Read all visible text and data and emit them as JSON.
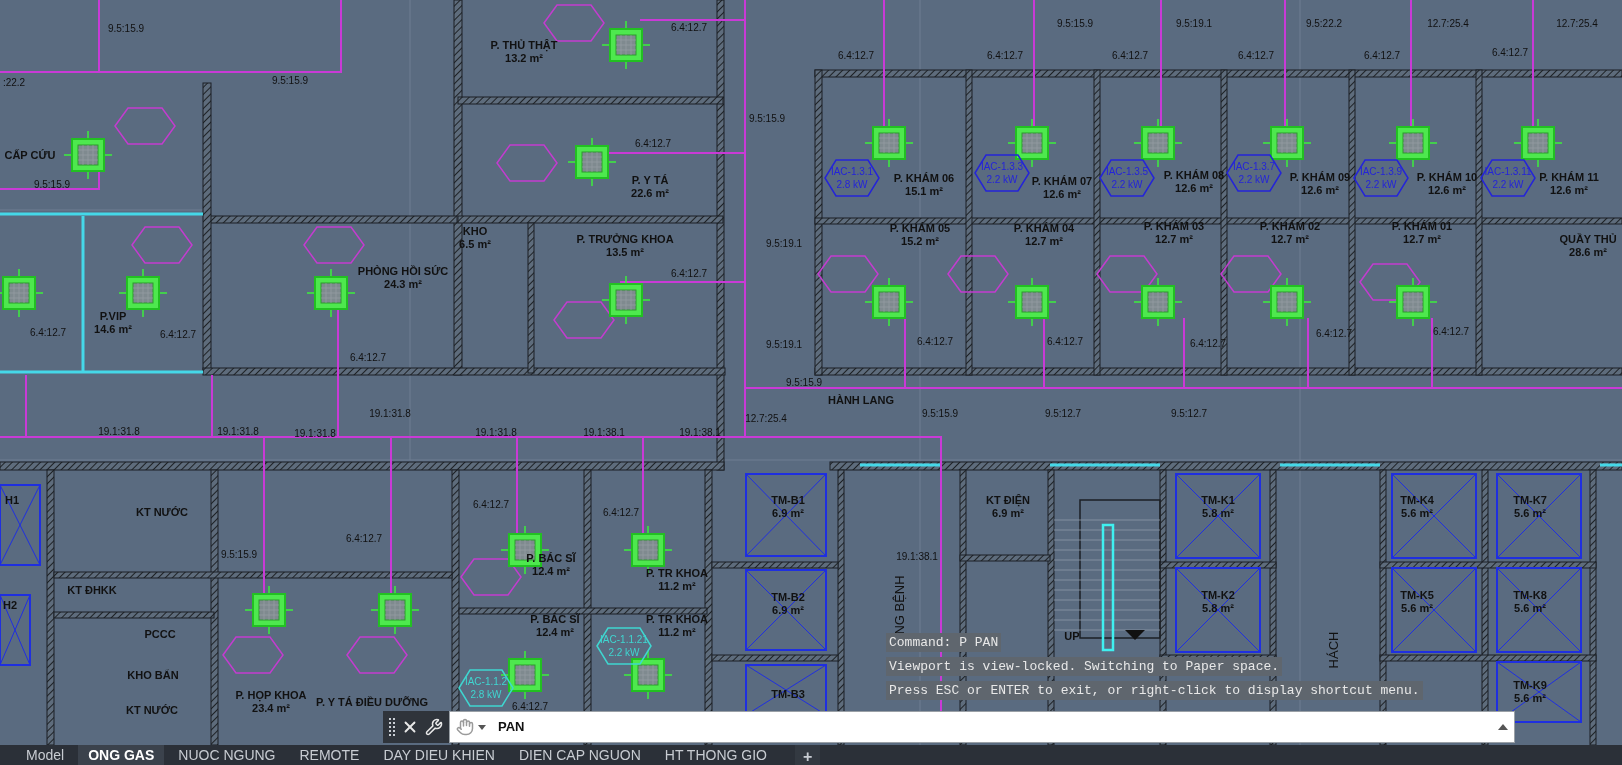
{
  "drawing": {
    "rooms": [
      {
        "name": "P. THỦ THẬT",
        "area": "13.2 m²"
      },
      {
        "name": "CẤP CỨU"
      },
      {
        "name": "P. Y TÁ",
        "area": "22.6 m²"
      },
      {
        "name": "KHO",
        "area": "6.5 m²"
      },
      {
        "name": "P. TRƯỞNG KHOA",
        "area": "13.5 m²"
      },
      {
        "name": "PHÒNG HỒI SỨC",
        "area": "24.3 m²"
      },
      {
        "name": "P.VIP",
        "area": "14.6 m²"
      },
      {
        "name": "P. KHÁM 06",
        "area": "15.1 m²"
      },
      {
        "name": "P. KHÁM 07",
        "area": "12.6 m²"
      },
      {
        "name": "P. KHÁM 08",
        "area": "12.6 m²"
      },
      {
        "name": "P. KHÁM 09",
        "area": "12.6 m²"
      },
      {
        "name": "P. KHÁM 10",
        "area": "12.6 m²"
      },
      {
        "name": "P. KHÁM 11",
        "area": "12.6 m²"
      },
      {
        "name": "P. KHÁM 05",
        "area": "15.2 m²"
      },
      {
        "name": "P. KHÁM 04",
        "area": "12.7 m²"
      },
      {
        "name": "P. KHÁM 03",
        "area": "12.7 m²"
      },
      {
        "name": "P. KHÁM 02",
        "area": "12.7 m²"
      },
      {
        "name": "P. KHÁM 01",
        "area": "12.7 m²"
      },
      {
        "name": "QUẦY THỦ",
        "area": "28.6 m²"
      },
      {
        "name": "HÀNH LANG"
      },
      {
        "name": "KT NƯỚC"
      },
      {
        "name": "KT ĐHKK"
      },
      {
        "name": "PCCC"
      },
      {
        "name": "KHO BẨN"
      },
      {
        "name": "KT NƯỚC"
      },
      {
        "name": "P. BÁC SĨ",
        "area": "12.4 m²"
      },
      {
        "name": "P. TR KHOA",
        "area": "11.2 m²"
      },
      {
        "name": "P. BÁC SĨ",
        "area": "12.4 m²"
      },
      {
        "name": "P. TR KHOA",
        "area": "11.2 m²"
      },
      {
        "name": "P. HỌP KHOA",
        "area": "23.4 m²"
      },
      {
        "name": "P. Y TÁ ĐIỀU DƯỠNG"
      },
      {
        "name": "TM-B1",
        "area": "6.9 m²"
      },
      {
        "name": "TM-B2",
        "area": "6.9 m²"
      },
      {
        "name": "TM-B3"
      },
      {
        "name": "KT ĐIỆN",
        "area": "6.9 m²"
      },
      {
        "name": "TM-K1",
        "area": "5.8 m²"
      },
      {
        "name": "TM-K2",
        "area": "5.8 m²"
      },
      {
        "name": "TM-K4",
        "area": "5.6 m²"
      },
      {
        "name": "TM-K5",
        "area": "5.6 m²"
      },
      {
        "name": "TM-K7",
        "area": "5.6 m²"
      },
      {
        "name": "TM-K8",
        "area": "5.6 m²"
      },
      {
        "name": "TM-K9",
        "area": "5.6 m²"
      },
      {
        "name": "UP"
      },
      {
        "name": "H1"
      },
      {
        "name": "H2"
      }
    ],
    "vertical_labels": [
      "NG BỆNH",
      "HÁCH"
    ],
    "pipe_labels": [
      "9.5:15.9",
      "6.4:12.7",
      "9.5:15.9",
      "9.5:19.1",
      "9.5:22.2",
      "12.7:25.4",
      "12.7:25.4",
      ":22.2",
      "9.5:15.9",
      "6.4:12.7",
      "6.4:12.7",
      "6.4:12.7",
      "6.4:12.7",
      "6.4:12.7",
      "6.4:12.7",
      "9.5:15.9",
      "6.4:12.7",
      "9.5:15.9",
      "9.5:19.1",
      "6.4:12.7",
      "6.4:12.7",
      "6.4:12.7",
      "6.4:12.7",
      "9.5:19.1",
      "6.4:12.7",
      "6.4:12.7",
      "6.4:12.7",
      "6.4:12.7",
      "6.4:12.7",
      "9.5:15.9",
      "12.7:25.4",
      "9.5:15.9",
      "9.5:12.7",
      "9.5:12.7",
      "19.1:31.8",
      "19.1:31.8",
      "19.1:31.8",
      "19.1:31.8",
      "19.1:31.8",
      "19.1:38.1",
      "19.1:38.1",
      "6.4:12.7",
      "6.4:12.7",
      "6.4:12.7",
      "9.5:15.9",
      "19.1:38.1",
      "6.4:12.7"
    ],
    "unit_tags": [
      {
        "code": "IAC-1.3.1",
        "power": "2.8 kW",
        "color": "#2424d8"
      },
      {
        "code": "IAC-1.3.3",
        "power": "2.2 kW",
        "color": "#2424d8"
      },
      {
        "code": "IAC-1.3.5",
        "power": "2.2 kW",
        "color": "#2424d8"
      },
      {
        "code": "IAC-1.3.7",
        "power": "2.2 kW",
        "color": "#2424d8"
      },
      {
        "code": "IAC-1.3.9",
        "power": "2.2 kW",
        "color": "#2424d8"
      },
      {
        "code": "IAC-1.3.11",
        "power": "2.2 kW",
        "color": "#2424d8"
      },
      {
        "code": "IAC-1.1.21",
        "power": "2.2 kW",
        "color": "#3fd6d0"
      },
      {
        "code": "IAC-1.1.2",
        "power": "2.8 kW",
        "color": "#3fd6d0"
      }
    ]
  },
  "command_history": [
    "Command: P PAN",
    "Viewport is view-locked. Switching to Paper space.",
    "Press ESC or ENTER to exit, or right-click to display shortcut menu."
  ],
  "command_line": {
    "value": "PAN"
  },
  "layout_tabs": [
    {
      "label": "Model",
      "selected": false
    },
    {
      "label": "ONG GAS",
      "selected": true
    },
    {
      "label": "NUOC NGUNG",
      "selected": false
    },
    {
      "label": "REMOTE",
      "selected": false
    },
    {
      "label": "DAY DIEU KHIEN",
      "selected": false
    },
    {
      "label": "DIEN CAP NGUON",
      "selected": false
    },
    {
      "label": "HT THONG GIO",
      "selected": false
    }
  ],
  "add_tab": "+"
}
